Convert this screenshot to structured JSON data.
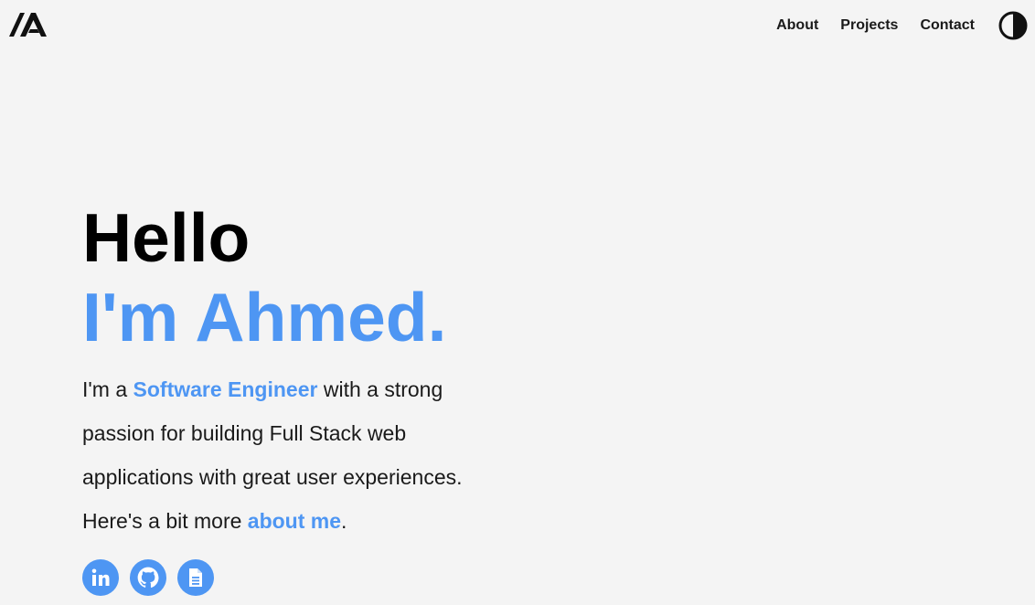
{
  "brand": {
    "logo_icon": "ia-monogram-logo"
  },
  "nav": {
    "items": [
      {
        "label": "About"
      },
      {
        "label": "Projects"
      },
      {
        "label": "Contact"
      }
    ],
    "theme_toggle_icon": "half-circle-contrast-icon"
  },
  "hero": {
    "greeting": "Hello",
    "name_line": "I'm Ahmed.",
    "intro": {
      "part1": "I'm a ",
      "highlight_role": "Software Engineer",
      "part2": " with a strong passion for building Full Stack web applications with great user experiences. Here's a bit more ",
      "about_link": "about me",
      "part3": "."
    }
  },
  "socials": [
    {
      "icon": "linkedin-icon"
    },
    {
      "icon": "github-icon"
    },
    {
      "icon": "document-icon"
    }
  ],
  "colors": {
    "accent": "#4e96f3",
    "background": "#f4f4f4",
    "text": "#111111"
  }
}
